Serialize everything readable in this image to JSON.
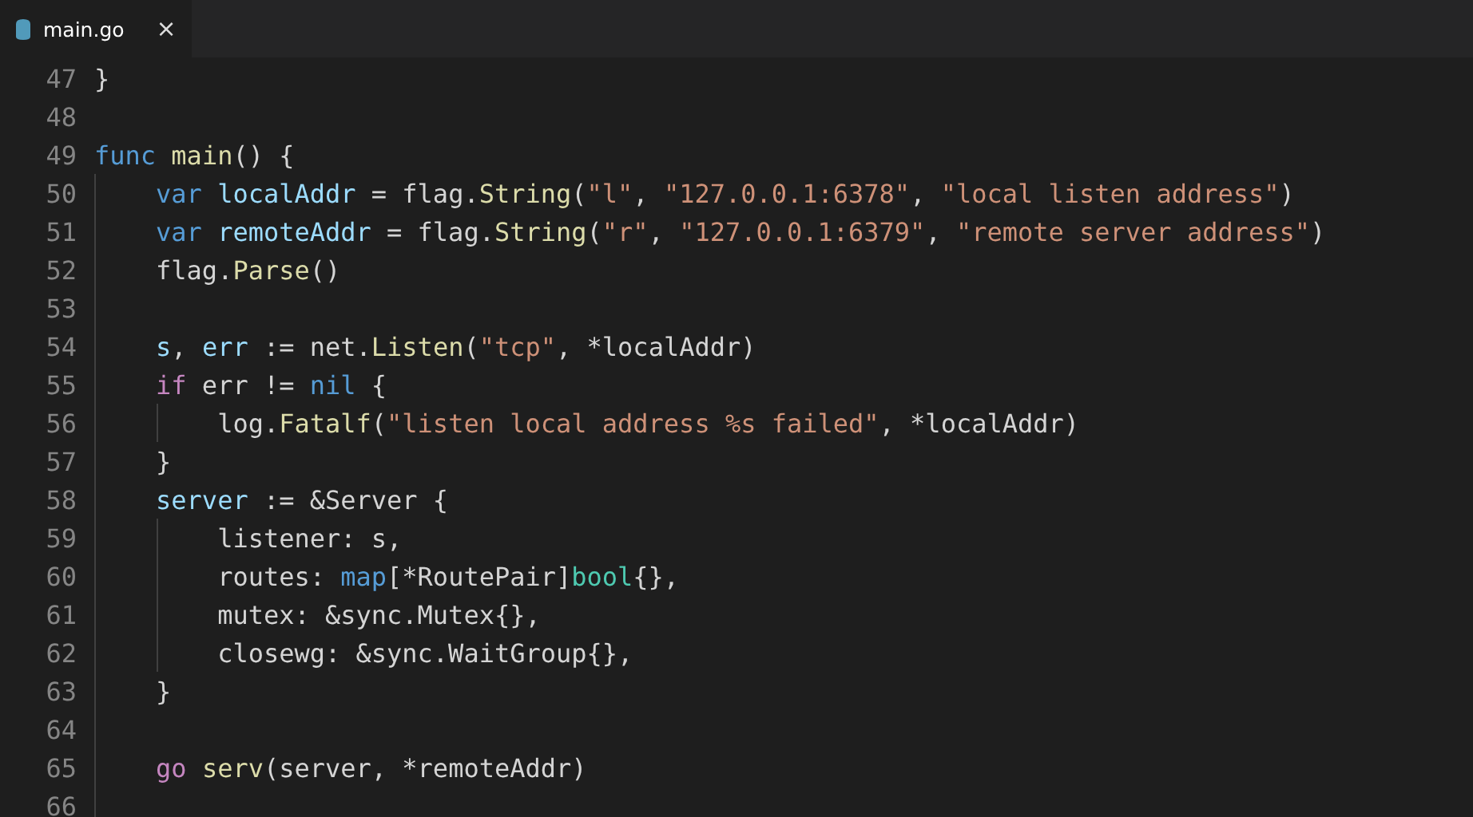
{
  "tabs": [
    {
      "label": "main.go",
      "selected": true,
      "close": "×"
    }
  ],
  "lines": [
    {
      "number": "47",
      "tokens": [
        {
          "kind": "plain",
          "text": "}"
        }
      ]
    },
    {
      "number": "48"
    },
    {
      "number": "49",
      "tokens": [
        {
          "kind": "storage",
          "text": "func "
        },
        {
          "kind": "function",
          "text": "main"
        },
        {
          "kind": "plain",
          "text": "() {"
        }
      ]
    },
    {
      "number": "50",
      "tokens": [
        {
          "kind": "storage",
          "text": "    var "
        },
        {
          "kind": "variable",
          "text": "localAddr"
        },
        {
          "kind": "plain",
          "text": " = flag."
        },
        {
          "kind": "function",
          "text": "String"
        },
        {
          "kind": "plain",
          "text": "("
        },
        {
          "kind": "string",
          "text": "\"l\""
        },
        {
          "kind": "plain",
          "text": ", "
        },
        {
          "kind": "string",
          "text": "\"127.0.0.1:6378\""
        },
        {
          "kind": "plain",
          "text": ", "
        },
        {
          "kind": "string",
          "text": "\"local listen address\""
        },
        {
          "kind": "plain",
          "text": ")"
        }
      ]
    },
    {
      "number": "51",
      "tokens": [
        {
          "kind": "storage",
          "text": "    var "
        },
        {
          "kind": "variable",
          "text": "remoteAddr"
        },
        {
          "kind": "plain",
          "text": " = flag."
        },
        {
          "kind": "function",
          "text": "String"
        },
        {
          "kind": "plain",
          "text": "("
        },
        {
          "kind": "string",
          "text": "\"r\""
        },
        {
          "kind": "plain",
          "text": ", "
        },
        {
          "kind": "string",
          "text": "\"127.0.0.1:6379\""
        },
        {
          "kind": "plain",
          "text": ", "
        },
        {
          "kind": "string",
          "text": "\"remote server address\""
        },
        {
          "kind": "plain",
          "text": ")"
        }
      ]
    },
    {
      "number": "52",
      "tokens": [
        {
          "kind": "plain",
          "text": "    flag."
        },
        {
          "kind": "function",
          "text": "Parse"
        },
        {
          "kind": "plain",
          "text": "()"
        }
      ]
    },
    {
      "number": "53"
    },
    {
      "number": "54",
      "tokens": [
        {
          "kind": "variable",
          "text": "    s"
        },
        {
          "kind": "plain",
          "text": ", "
        },
        {
          "kind": "variable",
          "text": "err"
        },
        {
          "kind": "plain",
          "text": " := net."
        },
        {
          "kind": "function",
          "text": "Listen"
        },
        {
          "kind": "plain",
          "text": "("
        },
        {
          "kind": "string",
          "text": "\"tcp\""
        },
        {
          "kind": "plain",
          "text": ", *localAddr)"
        }
      ]
    },
    {
      "number": "55",
      "tokens": [
        {
          "kind": "keyword",
          "text": "    if"
        },
        {
          "kind": "plain",
          "text": " err != "
        },
        {
          "kind": "storage",
          "text": "nil"
        },
        {
          "kind": "plain",
          "text": " {"
        }
      ]
    },
    {
      "number": "56",
      "tokens": [
        {
          "kind": "plain",
          "text": "        log."
        },
        {
          "kind": "function",
          "text": "Fatalf"
        },
        {
          "kind": "plain",
          "text": "("
        },
        {
          "kind": "string",
          "text": "\"listen local address %s failed\""
        },
        {
          "kind": "plain",
          "text": ", *localAddr)"
        }
      ]
    },
    {
      "number": "57",
      "tokens": [
        {
          "kind": "plain",
          "text": "    }"
        }
      ]
    },
    {
      "number": "58",
      "tokens": [
        {
          "kind": "variable",
          "text": "    server"
        },
        {
          "kind": "plain",
          "text": " := &Server {"
        }
      ]
    },
    {
      "number": "59",
      "tokens": [
        {
          "kind": "plain",
          "text": "        listener: s,"
        }
      ]
    },
    {
      "number": "60",
      "tokens": [
        {
          "kind": "plain",
          "text": "        routes: "
        },
        {
          "kind": "storage",
          "text": "map"
        },
        {
          "kind": "plain",
          "text": "[*RoutePair]"
        },
        {
          "kind": "type",
          "text": "bool"
        },
        {
          "kind": "plain",
          "text": "{},"
        }
      ]
    },
    {
      "number": "61",
      "tokens": [
        {
          "kind": "plain",
          "text": "        mutex: &sync.Mutex{},"
        }
      ]
    },
    {
      "number": "62",
      "tokens": [
        {
          "kind": "plain",
          "text": "        closewg: &sync.WaitGroup{},"
        }
      ]
    },
    {
      "number": "63",
      "tokens": [
        {
          "kind": "plain",
          "text": "    }"
        }
      ]
    },
    {
      "number": "64"
    },
    {
      "number": "65",
      "tokens": [
        {
          "kind": "keyword",
          "text": "    go "
        },
        {
          "kind": "function",
          "text": "serv"
        },
        {
          "kind": "plain",
          "text": "(server, *remoteAddr)"
        }
      ]
    },
    {
      "number": "66"
    }
  ]
}
